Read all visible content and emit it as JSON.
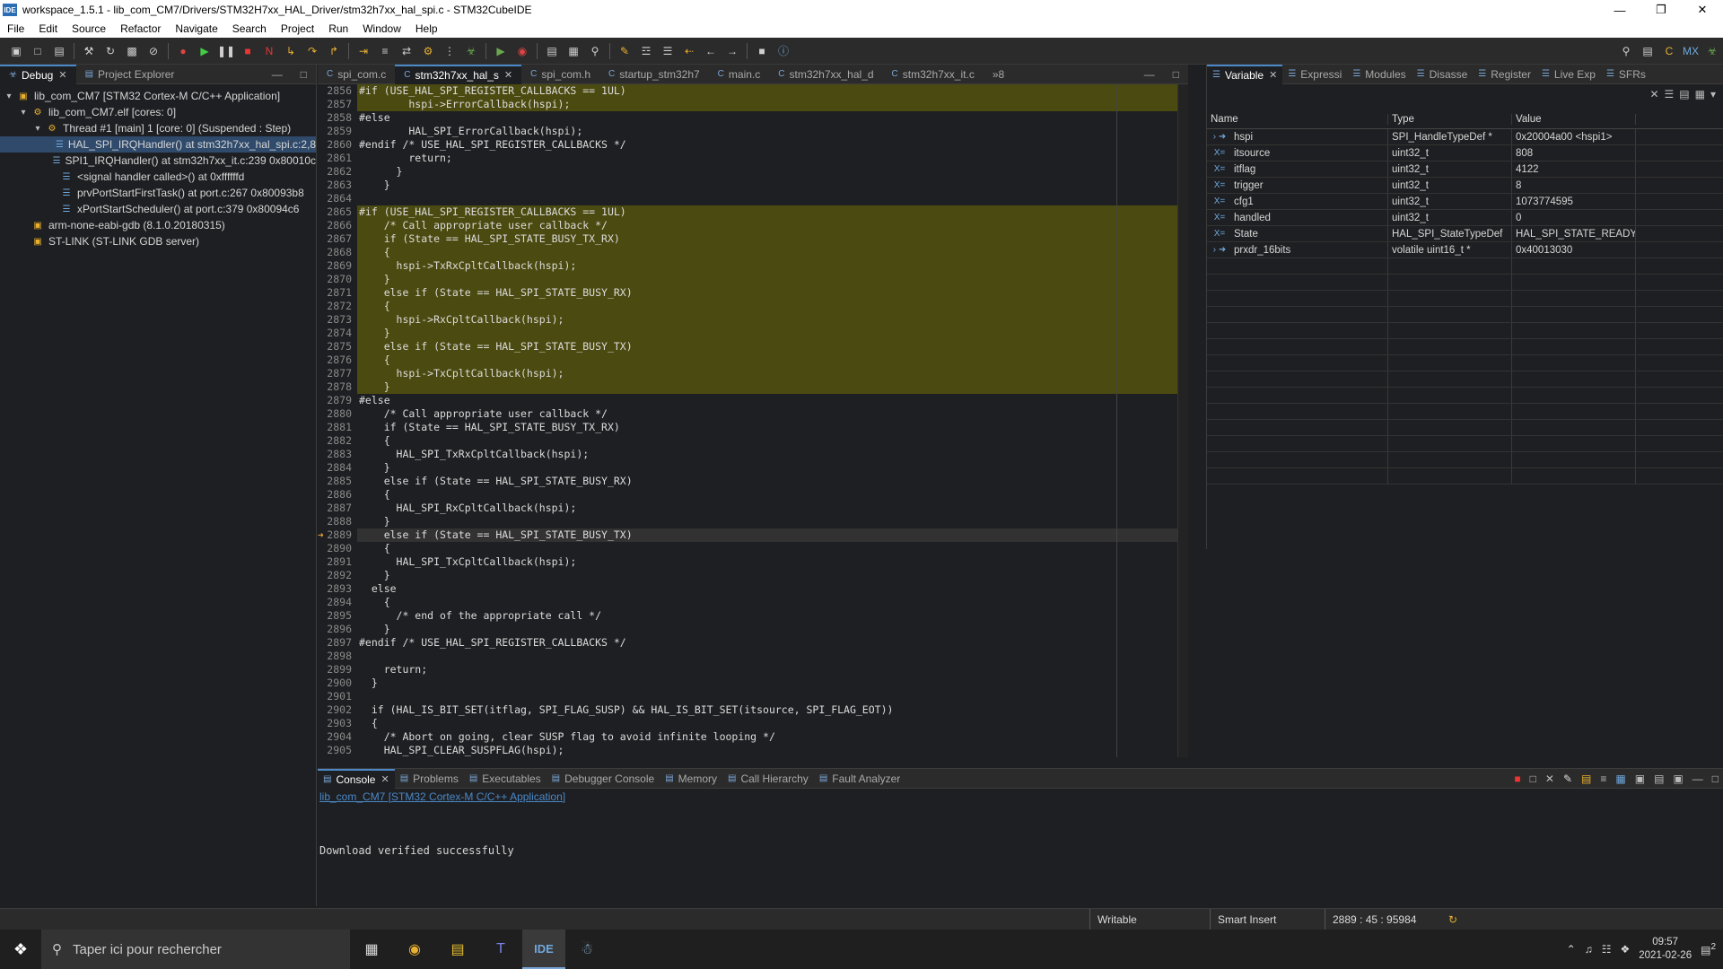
{
  "window": {
    "title": "workspace_1.5.1 - lib_com_CM7/Drivers/STM32H7xx_HAL_Driver/stm32h7xx_hal_spi.c - STM32CubeIDE",
    "app_icon": "IDE",
    "controls": [
      "minimize",
      "restore",
      "close"
    ]
  },
  "menu": [
    "File",
    "Edit",
    "Source",
    "Refactor",
    "Navigate",
    "Search",
    "Project",
    "Run",
    "Window",
    "Help"
  ],
  "debug_view": {
    "tabs": [
      {
        "label": "Debug",
        "active": true
      },
      {
        "label": "Project Explorer",
        "active": false
      }
    ],
    "tree": [
      {
        "label": "lib_com_CM7 [STM32 Cortex-M C/C++ Application]",
        "level": 0,
        "expanded": true,
        "icon": "ide-app-icon"
      },
      {
        "label": "lib_com_CM7.elf [cores: 0]",
        "level": 1,
        "expanded": true,
        "icon": "process-icon"
      },
      {
        "label": "Thread #1 [main] 1 [core: 0] (Suspended : Step)",
        "level": 2,
        "expanded": true,
        "icon": "thread-icon"
      },
      {
        "label": "HAL_SPI_IRQHandler() at stm32h7xx_hal_spi.c:2,8",
        "level": 3,
        "icon": "stack-frame-icon",
        "selected": true
      },
      {
        "label": "SPI1_IRQHandler() at stm32h7xx_it.c:239 0x80010c",
        "level": 3,
        "icon": "stack-frame-icon"
      },
      {
        "label": "<signal handler called>() at 0xffffffd",
        "level": 3,
        "icon": "stack-frame-icon"
      },
      {
        "label": "prvPortStartFirstTask() at port.c:267 0x80093b8",
        "level": 3,
        "icon": "stack-frame-icon"
      },
      {
        "label": "xPortStartScheduler() at port.c:379 0x80094c6",
        "level": 3,
        "icon": "stack-frame-icon"
      },
      {
        "label": "arm-none-eabi-gdb (8.1.0.20180315)",
        "level": 1,
        "icon": "gdb-icon"
      },
      {
        "label": "ST-LINK (ST-LINK GDB server)",
        "level": 1,
        "icon": "stlink-icon"
      }
    ]
  },
  "editor": {
    "tabs": [
      {
        "label": "spi_com.c",
        "active": false
      },
      {
        "label": "stm32h7xx_hal_s",
        "active": true
      },
      {
        "label": "spi_com.h",
        "active": false
      },
      {
        "label": "startup_stm32h7",
        "active": false
      },
      {
        "label": "main.c",
        "active": false
      },
      {
        "label": "stm32h7xx_hal_d",
        "active": false
      },
      {
        "label": "stm32h7xx_it.c",
        "active": false
      }
    ],
    "overflow_count": "8",
    "current_line": "2889",
    "lines": [
      {
        "n": "2856",
        "t": "#if (USE_HAL_SPI_REGISTER_CALLBACKS == 1UL)",
        "hl": true
      },
      {
        "n": "2857",
        "t": "        hspi->ErrorCallback(hspi);",
        "hl": true
      },
      {
        "n": "2858",
        "t": "#else",
        "hl": false
      },
      {
        "n": "2859",
        "t": "        HAL_SPI_ErrorCallback(hspi);",
        "hl": false
      },
      {
        "n": "2860",
        "t": "#endif /* USE_HAL_SPI_REGISTER_CALLBACKS */",
        "hl": false
      },
      {
        "n": "2861",
        "t": "        return;",
        "hl": false
      },
      {
        "n": "2862",
        "t": "      }",
        "hl": false
      },
      {
        "n": "2863",
        "t": "    }",
        "hl": false
      },
      {
        "n": "2864",
        "t": "",
        "hl": false
      },
      {
        "n": "2865",
        "t": "#if (USE_HAL_SPI_REGISTER_CALLBACKS == 1UL)",
        "hl": true
      },
      {
        "n": "2866",
        "t": "    /* Call appropriate user callback */",
        "hl": true
      },
      {
        "n": "2867",
        "t": "    if (State == HAL_SPI_STATE_BUSY_TX_RX)",
        "hl": true
      },
      {
        "n": "2868",
        "t": "    {",
        "hl": true
      },
      {
        "n": "2869",
        "t": "      hspi->TxRxCpltCallback(hspi);",
        "hl": true
      },
      {
        "n": "2870",
        "t": "    }",
        "hl": true
      },
      {
        "n": "2871",
        "t": "    else if (State == HAL_SPI_STATE_BUSY_RX)",
        "hl": true
      },
      {
        "n": "2872",
        "t": "    {",
        "hl": true
      },
      {
        "n": "2873",
        "t": "      hspi->RxCpltCallback(hspi);",
        "hl": true
      },
      {
        "n": "2874",
        "t": "    }",
        "hl": true
      },
      {
        "n": "2875",
        "t": "    else if (State == HAL_SPI_STATE_BUSY_TX)",
        "hl": true
      },
      {
        "n": "2876",
        "t": "    {",
        "hl": true
      },
      {
        "n": "2877",
        "t": "      hspi->TxCpltCallback(hspi);",
        "hl": true
      },
      {
        "n": "2878",
        "t": "    }",
        "hl": true
      },
      {
        "n": "2879",
        "t": "#else",
        "hl": false
      },
      {
        "n": "2880",
        "t": "    /* Call appropriate user callback */",
        "hl": false
      },
      {
        "n": "2881",
        "t": "    if (State == HAL_SPI_STATE_BUSY_TX_RX)",
        "hl": false
      },
      {
        "n": "2882",
        "t": "    {",
        "hl": false
      },
      {
        "n": "2883",
        "t": "      HAL_SPI_TxRxCpltCallback(hspi);",
        "hl": false
      },
      {
        "n": "2884",
        "t": "    }",
        "hl": false
      },
      {
        "n": "2885",
        "t": "    else if (State == HAL_SPI_STATE_BUSY_RX)",
        "hl": false
      },
      {
        "n": "2886",
        "t": "    {",
        "hl": false
      },
      {
        "n": "2887",
        "t": "      HAL_SPI_RxCpltCallback(hspi);",
        "hl": false
      },
      {
        "n": "2888",
        "t": "    }",
        "hl": false
      },
      {
        "n": "2889",
        "t": "    else if (State == HAL_SPI_STATE_BUSY_TX)",
        "hl": false,
        "cur": true
      },
      {
        "n": "2890",
        "t": "    {",
        "hl": false
      },
      {
        "n": "2891",
        "t": "      HAL_SPI_TxCpltCallback(hspi);",
        "hl": false
      },
      {
        "n": "2892",
        "t": "    }",
        "hl": false
      },
      {
        "n": "2893",
        "t": "  else",
        "hl": false
      },
      {
        "n": "2894",
        "t": "    {",
        "hl": false
      },
      {
        "n": "2895",
        "t": "      /* end of the appropriate call */",
        "hl": false
      },
      {
        "n": "2896",
        "t": "    }",
        "hl": false
      },
      {
        "n": "2897",
        "t": "#endif /* USE_HAL_SPI_REGISTER_CALLBACKS */",
        "hl": false
      },
      {
        "n": "2898",
        "t": "",
        "hl": false
      },
      {
        "n": "2899",
        "t": "    return;",
        "hl": false
      },
      {
        "n": "2900",
        "t": "  }",
        "hl": false
      },
      {
        "n": "2901",
        "t": "",
        "hl": false
      },
      {
        "n": "2902",
        "t": "  if (HAL_IS_BIT_SET(itflag, SPI_FLAG_SUSP) && HAL_IS_BIT_SET(itsource, SPI_FLAG_EOT))",
        "hl": false
      },
      {
        "n": "2903",
        "t": "  {",
        "hl": false
      },
      {
        "n": "2904",
        "t": "    /* Abort on going, clear SUSP flag to avoid infinite looping */",
        "hl": false
      },
      {
        "n": "2905",
        "t": "    HAL_SPI_CLEAR_SUSPFLAG(hspi);",
        "hl": false
      }
    ]
  },
  "variables_view": {
    "tabs": [
      {
        "label": "Variable",
        "active": true
      },
      {
        "label": "Expressi",
        "active": false
      },
      {
        "label": "Modules",
        "active": false
      },
      {
        "label": "Disasse",
        "active": false
      },
      {
        "label": "Register",
        "active": false
      },
      {
        "label": "Live Exp",
        "active": false
      },
      {
        "label": "SFRs",
        "active": false
      }
    ],
    "columns": [
      "Name",
      "Type",
      "Value"
    ],
    "rows": [
      {
        "name": "hspi",
        "type": "SPI_HandleTypeDef *",
        "value": "0x20004a00 <hspi1>",
        "icon": "pointer-icon",
        "expandable": true
      },
      {
        "name": "itsource",
        "type": "uint32_t",
        "value": "808",
        "icon": "variable-icon",
        "expandable": false
      },
      {
        "name": "itflag",
        "type": "uint32_t",
        "value": "4122",
        "icon": "variable-icon",
        "expandable": false
      },
      {
        "name": "trigger",
        "type": "uint32_t",
        "value": "8",
        "icon": "variable-icon",
        "expandable": false
      },
      {
        "name": "cfg1",
        "type": "uint32_t",
        "value": "1073774595",
        "icon": "variable-icon",
        "expandable": false
      },
      {
        "name": "handled",
        "type": "uint32_t",
        "value": "0",
        "icon": "variable-icon",
        "expandable": false
      },
      {
        "name": "State",
        "type": "HAL_SPI_StateTypeDef",
        "value": "HAL_SPI_STATE_READY",
        "icon": "variable-icon",
        "expandable": false
      },
      {
        "name": "prxdr_16bits",
        "type": "volatile uint16_t *",
        "value": "0x40013030",
        "icon": "pointer-icon",
        "expandable": true
      }
    ]
  },
  "console": {
    "tabs": [
      {
        "label": "Console",
        "active": true
      },
      {
        "label": "Problems",
        "active": false
      },
      {
        "label": "Executables",
        "active": false
      },
      {
        "label": "Debugger Console",
        "active": false
      },
      {
        "label": "Memory",
        "active": false
      },
      {
        "label": "Call Hierarchy",
        "active": false
      },
      {
        "label": "Fault Analyzer",
        "active": false
      }
    ],
    "launch": "lib_com_CM7 [STM32 Cortex-M C/C++ Application]",
    "output": "Download verified successfully"
  },
  "status": {
    "writable": "Writable",
    "insert_mode": "Smart Insert",
    "position": "2889 : 45 : 95984"
  },
  "taskbar": {
    "search_placeholder": "Taper ici pour rechercher",
    "time": "09:57",
    "date": "2021-02-26",
    "notifications": "2"
  },
  "colors": {
    "accent": "#4a88c7",
    "highlight": "#4b4a10",
    "breakpoint_arrow": "#f0a030"
  }
}
